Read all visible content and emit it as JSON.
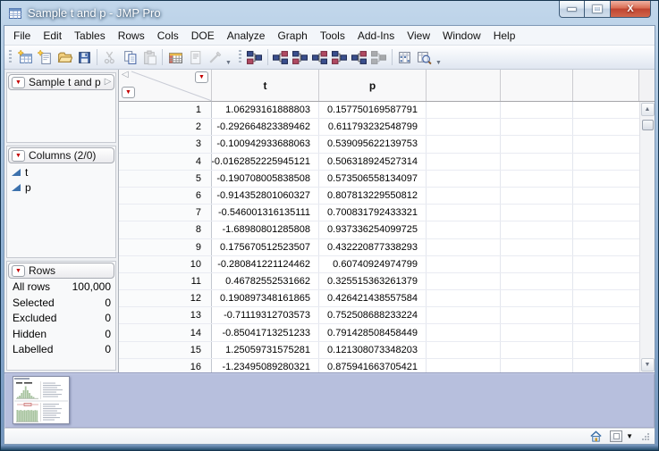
{
  "window": {
    "title": "Sample t and p - JMP Pro"
  },
  "menu": {
    "items": [
      "File",
      "Edit",
      "Tables",
      "Rows",
      "Cols",
      "DOE",
      "Analyze",
      "Graph",
      "Tools",
      "Add-Ins",
      "View",
      "Window",
      "Help"
    ]
  },
  "toolbar": {
    "groups": [
      {
        "buttons": [
          {
            "name": "new-data-table",
            "kind": "table-star"
          },
          {
            "name": "new-journal",
            "kind": "page-star"
          },
          {
            "name": "open-file",
            "kind": "folder"
          },
          {
            "name": "save-file",
            "kind": "floppy"
          },
          {
            "kind": "sep"
          },
          {
            "name": "cut",
            "kind": "scissors",
            "disabled": true
          },
          {
            "name": "copy",
            "kind": "copy"
          },
          {
            "name": "paste",
            "kind": "paste",
            "disabled": true
          },
          {
            "kind": "sep"
          },
          {
            "name": "data-table-grid",
            "kind": "grid"
          },
          {
            "name": "journal-page",
            "kind": "page-red",
            "disabled": true
          },
          {
            "name": "script-tool",
            "kind": "wrench",
            "disabled": true
          }
        ]
      },
      {
        "buttons": [
          {
            "name": "platform-1",
            "kind": "nodes"
          },
          {
            "kind": "sep"
          },
          {
            "name": "platform-2",
            "kind": "nodes2"
          },
          {
            "name": "platform-3",
            "kind": "nodes"
          },
          {
            "name": "platform-4",
            "kind": "nodes2"
          },
          {
            "name": "platform-5",
            "kind": "nodes"
          },
          {
            "name": "platform-6",
            "kind": "nodes2"
          },
          {
            "name": "platform-7",
            "kind": "nodes",
            "disabled": true
          },
          {
            "kind": "sep"
          },
          {
            "name": "columns-viewer",
            "kind": "colviewer"
          },
          {
            "name": "search-table",
            "kind": "search"
          }
        ]
      }
    ]
  },
  "sidebar": {
    "table_panel": {
      "title": "Sample t and p"
    },
    "columns_panel": {
      "title": "Columns (2/0)",
      "items": [
        "t",
        "p"
      ]
    },
    "rows_panel": {
      "title": "Rows",
      "stats": [
        {
          "label": "All rows",
          "value": "100,000"
        },
        {
          "label": "Selected",
          "value": "0"
        },
        {
          "label": "Excluded",
          "value": "0"
        },
        {
          "label": "Hidden",
          "value": "0"
        },
        {
          "label": "Labelled",
          "value": "0"
        }
      ]
    }
  },
  "table": {
    "columns": [
      "t",
      "p"
    ],
    "rows": [
      [
        "1",
        "1.06293161888803",
        "0.157750169587791"
      ],
      [
        "2",
        "-0.292664823389462",
        "0.611793232548799"
      ],
      [
        "3",
        "-0.100942933688063",
        "0.539095622139753"
      ],
      [
        "4",
        "-0.0162852225945121",
        "0.506318924527314"
      ],
      [
        "5",
        "-0.190708005838508",
        "0.573506558134097"
      ],
      [
        "6",
        "-0.914352801060327",
        "0.807813229550812"
      ],
      [
        "7",
        "-0.546001316135111",
        "0.700831792433321"
      ],
      [
        "8",
        "-1.68980801285808",
        "0.937336254099725"
      ],
      [
        "9",
        "0.175670512523507",
        "0.432220877338293"
      ],
      [
        "10",
        "-0.280841221124462",
        "0.60740924974799"
      ],
      [
        "11",
        "0.46782552531662",
        "0.325515363261379"
      ],
      [
        "12",
        "0.190897348161865",
        "0.426421438557584"
      ],
      [
        "13",
        "-0.71119312703573",
        "0.752508688233224"
      ],
      [
        "14",
        "-0.85041713251233",
        "0.791428508458449"
      ],
      [
        "15",
        "1.25059731575281",
        "0.121308073348203"
      ],
      [
        "16",
        "-1.23495089280321",
        "0.875941663705421"
      ]
    ]
  },
  "icons": {
    "up_arrow": "▲",
    "down_arrow": "▼",
    "red_triangle": "▼",
    "collapse_left": "◁",
    "collapse_right": "▷",
    "window_menu_arrow": "▼",
    "close_glyph": "X"
  }
}
